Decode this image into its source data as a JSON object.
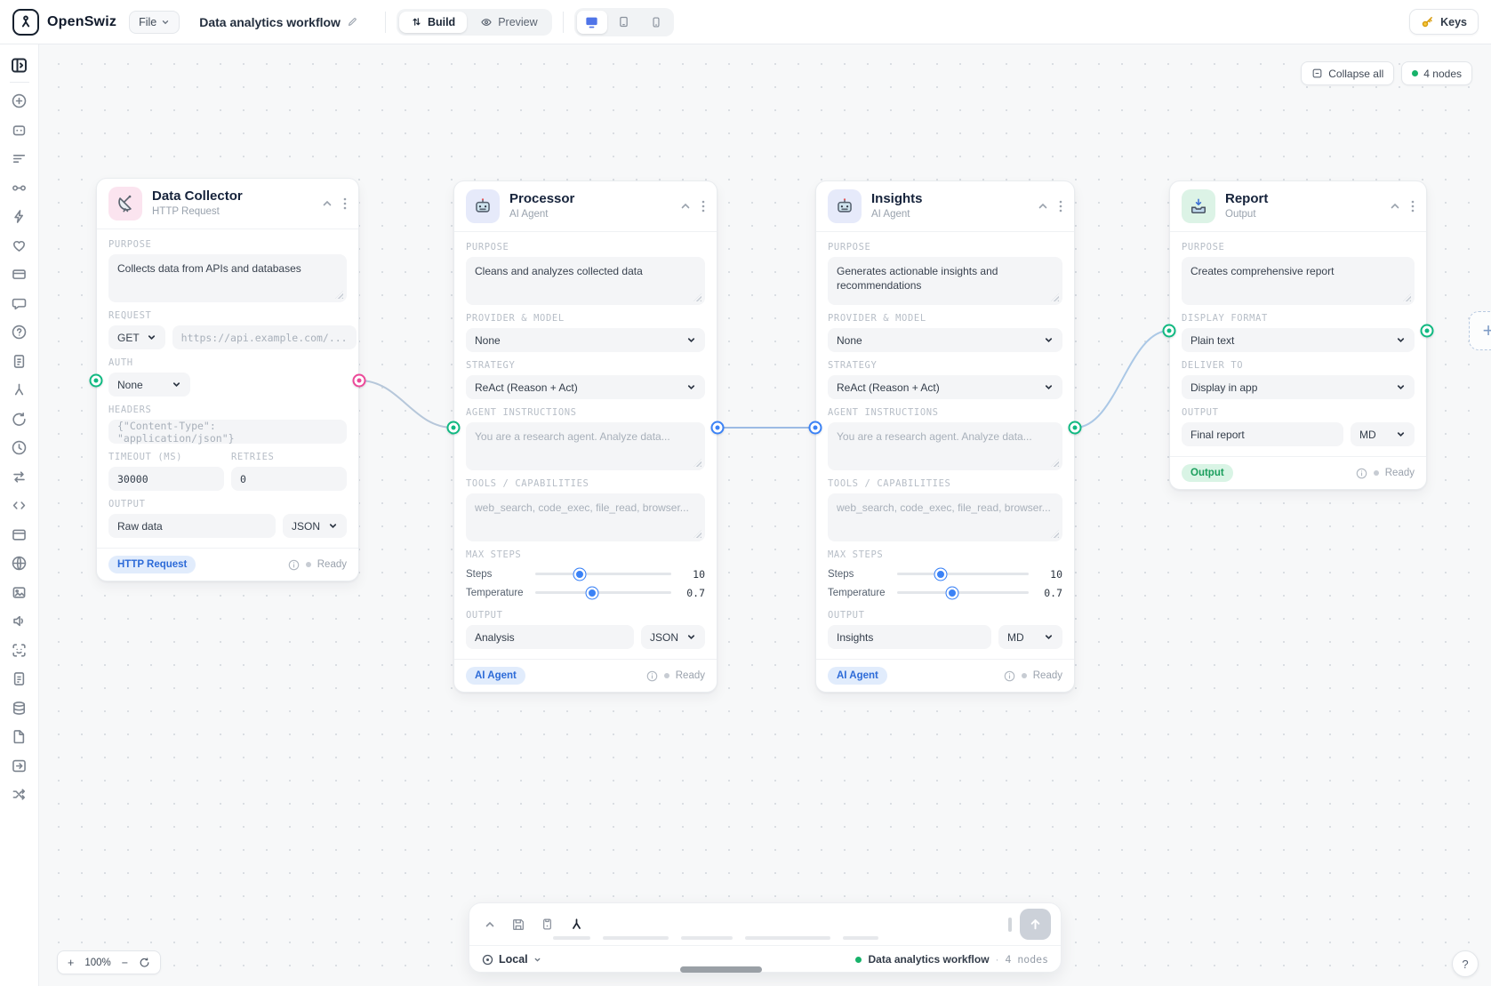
{
  "topbar": {
    "brand": "OpenSwiz",
    "file_button": "File",
    "workflow_title": "Data analytics workflow",
    "build_label": "Build",
    "preview_label": "Preview",
    "keys_label": "Keys"
  },
  "canvas_controls": {
    "collapse_all": "Collapse all",
    "nodes_badge": "4 nodes",
    "zoom_in": "+",
    "zoom_level": "100%",
    "zoom_out": "−",
    "help": "?"
  },
  "labels": {
    "purpose": "PURPOSE",
    "request": "REQUEST",
    "auth": "AUTH",
    "headers": "HEADERS",
    "timeout": "TIMEOUT (MS)",
    "retries": "RETRIES",
    "output": "OUTPUT",
    "provider_model": "PROVIDER & MODEL",
    "strategy": "STRATEGY",
    "agent_instructions": "AGENT INSTRUCTIONS",
    "tools": "TOOLS / CAPABILITIES",
    "max_steps": "MAX STEPS",
    "steps": "Steps",
    "temperature": "Temperature",
    "display_format": "DISPLAY FORMAT",
    "deliver_to": "DELIVER TO"
  },
  "nodes": {
    "collector": {
      "title": "Data Collector",
      "subtitle": "HTTP Request",
      "icon": "satellite-dish",
      "purpose": "Collects data from APIs and databases",
      "method": "GET",
      "url_placeholder": "https://api.example.com/...",
      "auth": "None",
      "headers_placeholder": "{\"Content-Type\": \"application/json\"}",
      "timeout": "30000",
      "retries": "0",
      "output_name": "Raw data",
      "output_format": "JSON",
      "badge": "HTTP Request",
      "status": "Ready"
    },
    "processor": {
      "title": "Processor",
      "subtitle": "AI Agent",
      "icon": "robot",
      "purpose": "Cleans and analyzes collected data",
      "provider": "None",
      "strategy": "ReAct (Reason + Act)",
      "instructions_placeholder": "You are a research agent. Analyze data...",
      "tools_placeholder": "web_search, code_exec, file_read, browser...",
      "steps_value": "10",
      "temperature_value": "0.7",
      "output_name": "Analysis",
      "output_format": "JSON",
      "badge": "AI Agent",
      "status": "Ready"
    },
    "insights": {
      "title": "Insights",
      "subtitle": "AI Agent",
      "icon": "robot",
      "purpose": "Generates actionable insights and recommendations",
      "provider": "None",
      "strategy": "ReAct (Reason + Act)",
      "instructions_placeholder": "You are a research agent. Analyze data...",
      "tools_placeholder": "web_search, code_exec, file_read, browser...",
      "steps_value": "10",
      "temperature_value": "0.7",
      "output_name": "Insights",
      "output_format": "MD",
      "badge": "AI Agent",
      "status": "Ready"
    },
    "report": {
      "title": "Report",
      "subtitle": "Output",
      "icon": "inbox-tray",
      "purpose": "Creates comprehensive report",
      "display_format": "Plain text",
      "deliver_to": "Display in app",
      "output_name": "Final report",
      "output_format": "MD",
      "badge": "Output",
      "status": "Ready"
    },
    "status_ready": "Ready"
  },
  "bottom_panel": {
    "environment": "Local",
    "workflow_name": "Data analytics workflow",
    "nodes_count": "4 nodes"
  },
  "sidebar": {
    "icons": [
      "panel-toggle",
      "add-circle",
      "bot",
      "filter",
      "connection",
      "zap",
      "heart",
      "credit-card",
      "chat",
      "help-circle",
      "notes",
      "merge",
      "refresh",
      "history",
      "swap",
      "code",
      "window",
      "globe",
      "image",
      "audio",
      "scan-face",
      "document",
      "database",
      "file",
      "export",
      "shuffle"
    ]
  },
  "colors": {
    "accent_blue": "#3b82f6",
    "port_green": "#10b981",
    "port_pink": "#ec4899",
    "status_green": "#17b26a",
    "badge_blue_bg": "#e1ecfc",
    "badge_green_bg": "#d9f4e5"
  }
}
